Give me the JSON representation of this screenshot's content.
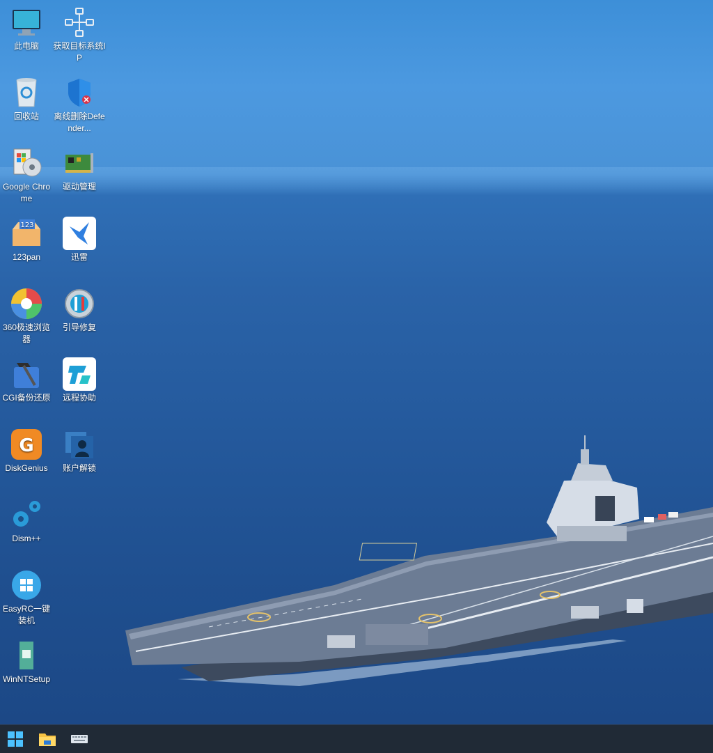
{
  "desktop": {
    "icons": [
      {
        "label": "此电脑",
        "icon": "computer-icon"
      },
      {
        "label": "获取目标系统IP",
        "icon": "network-icon"
      },
      {
        "label": "回收站",
        "icon": "recycle-bin-icon"
      },
      {
        "label": "离线删除Defender...",
        "icon": "defender-shield-icon"
      },
      {
        "label": "Google Chrome",
        "icon": "installer-box-icon"
      },
      {
        "label": "驱动管理",
        "icon": "driver-card-icon"
      },
      {
        "label": "123pan",
        "icon": "123pan-icon"
      },
      {
        "label": "迅雷",
        "icon": "thunder-bird-icon"
      },
      {
        "label": "360极速浏览器",
        "icon": "360-browser-icon"
      },
      {
        "label": "引导修复",
        "icon": "boot-repair-gear-icon"
      },
      {
        "label": "CGI备份还原",
        "icon": "cgi-hammer-icon"
      },
      {
        "label": "远程协助",
        "icon": "remote-assist-icon"
      },
      {
        "label": "DiskGenius",
        "icon": "diskgenius-icon"
      },
      {
        "label": "账户解锁",
        "icon": "account-unlock-icon"
      },
      {
        "label": "Dism++",
        "icon": "gears-icon"
      },
      {
        "label": "EasyRC一键装机",
        "icon": "windows-circle-icon"
      },
      {
        "label": "WinNTSetup",
        "icon": "winntsetup-icon"
      }
    ]
  },
  "taskbar": {
    "buttons": [
      {
        "name": "start",
        "icon": "windows-start-icon"
      },
      {
        "name": "file-explorer",
        "icon": "folder-icon"
      },
      {
        "name": "keyboard",
        "icon": "keyboard-icon"
      }
    ]
  },
  "colors": {
    "sky": "#4a96dd",
    "sea": "#22569a",
    "taskbar": "#202a36"
  }
}
